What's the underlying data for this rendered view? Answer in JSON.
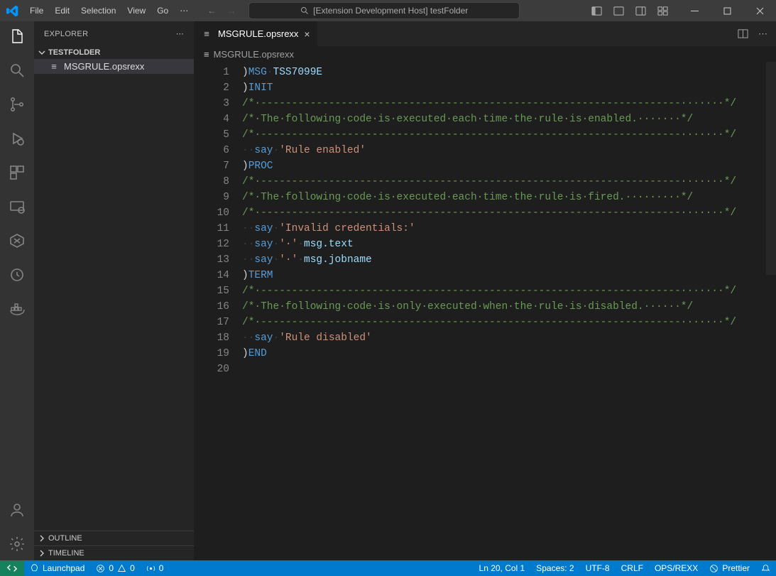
{
  "menu": {
    "file": "File",
    "edit": "Edit",
    "selection": "Selection",
    "view": "View",
    "go": "Go",
    "more": "⋯"
  },
  "search": {
    "text": "[Extension Development Host] testFolder"
  },
  "explorer": {
    "title": "EXPLORER",
    "folder": "TESTFOLDER",
    "file": "MSGRULE.opsrexx",
    "outline": "OUTLINE",
    "timeline": "TIMELINE"
  },
  "tab": {
    "name": "MSGRULE.opsrexx"
  },
  "breadcrumb": {
    "file": "MSGRULE.opsrexx"
  },
  "code": {
    "lines": [
      {
        "n": 1,
        "seg": [
          {
            "c": "p",
            "t": ")"
          },
          {
            "c": "kw",
            "t": "MSG"
          },
          {
            "c": "ws",
            "t": "·"
          },
          {
            "c": "id",
            "t": "TSS7099E"
          }
        ]
      },
      {
        "n": 2,
        "seg": [
          {
            "c": "p",
            "t": ")"
          },
          {
            "c": "kw",
            "t": "INIT"
          }
        ]
      },
      {
        "n": 3,
        "seg": [
          {
            "c": "cm",
            "t": "/*·--------------------------------------------------------------------·······*/"
          }
        ]
      },
      {
        "n": 4,
        "seg": [
          {
            "c": "cm",
            "t": "/*·The·following·code·is·executed·each·time·the·rule·is·enabled.·······*/"
          }
        ]
      },
      {
        "n": 5,
        "seg": [
          {
            "c": "cm",
            "t": "/*·--------------------------------------------------------------------·······*/"
          }
        ]
      },
      {
        "n": 6,
        "seg": [
          {
            "c": "ws",
            "t": "··"
          },
          {
            "c": "kw",
            "t": "say"
          },
          {
            "c": "ws",
            "t": "·"
          },
          {
            "c": "str",
            "t": "'Rule enabled'"
          }
        ]
      },
      {
        "n": 7,
        "seg": [
          {
            "c": "p",
            "t": ")"
          },
          {
            "c": "kw",
            "t": "PROC"
          }
        ]
      },
      {
        "n": 8,
        "seg": [
          {
            "c": "cm",
            "t": "/*·--------------------------------------------------------------------·······*/"
          }
        ]
      },
      {
        "n": 9,
        "seg": [
          {
            "c": "cm",
            "t": "/*·The·following·code·is·executed·each·time·the·rule·is·fired.·········*/"
          }
        ]
      },
      {
        "n": 10,
        "seg": [
          {
            "c": "cm",
            "t": "/*·--------------------------------------------------------------------·······*/"
          }
        ]
      },
      {
        "n": 11,
        "seg": [
          {
            "c": "ws",
            "t": "··"
          },
          {
            "c": "kw",
            "t": "say"
          },
          {
            "c": "ws",
            "t": "·"
          },
          {
            "c": "str",
            "t": "'Invalid credentials:'"
          }
        ]
      },
      {
        "n": 12,
        "seg": [
          {
            "c": "ws",
            "t": "··"
          },
          {
            "c": "kw",
            "t": "say"
          },
          {
            "c": "ws",
            "t": "·"
          },
          {
            "c": "str",
            "t": "'·'"
          },
          {
            "c": "ws",
            "t": "·"
          },
          {
            "c": "id",
            "t": "msg.text"
          }
        ]
      },
      {
        "n": 13,
        "seg": [
          {
            "c": "ws",
            "t": "··"
          },
          {
            "c": "kw",
            "t": "say"
          },
          {
            "c": "ws",
            "t": "·"
          },
          {
            "c": "str",
            "t": "'·'"
          },
          {
            "c": "ws",
            "t": "·"
          },
          {
            "c": "id",
            "t": "msg.jobname"
          }
        ]
      },
      {
        "n": 14,
        "seg": [
          {
            "c": "p",
            "t": ")"
          },
          {
            "c": "kw",
            "t": "TERM"
          }
        ]
      },
      {
        "n": 15,
        "seg": [
          {
            "c": "cm",
            "t": "/*·--------------------------------------------------------------------·······*/"
          }
        ]
      },
      {
        "n": 16,
        "seg": [
          {
            "c": "cm",
            "t": "/*·The·following·code·is·only·executed·when·the·rule·is·disabled.······*/"
          }
        ]
      },
      {
        "n": 17,
        "seg": [
          {
            "c": "cm",
            "t": "/*·--------------------------------------------------------------------·······*/"
          }
        ]
      },
      {
        "n": 18,
        "seg": [
          {
            "c": "ws",
            "t": "··"
          },
          {
            "c": "kw",
            "t": "say"
          },
          {
            "c": "ws",
            "t": "·"
          },
          {
            "c": "str",
            "t": "'Rule disabled'"
          }
        ]
      },
      {
        "n": 19,
        "seg": [
          {
            "c": "p",
            "t": ")"
          },
          {
            "c": "kw",
            "t": "END"
          }
        ]
      },
      {
        "n": 20,
        "seg": []
      }
    ]
  },
  "status": {
    "launchpad": "Launchpad",
    "errors": "0",
    "warnings": "0",
    "ports": "0",
    "lncol": "Ln 20, Col 1",
    "spaces": "Spaces: 2",
    "encoding": "UTF-8",
    "eol": "CRLF",
    "lang": "OPS/REXX",
    "prettier": "Prettier"
  }
}
